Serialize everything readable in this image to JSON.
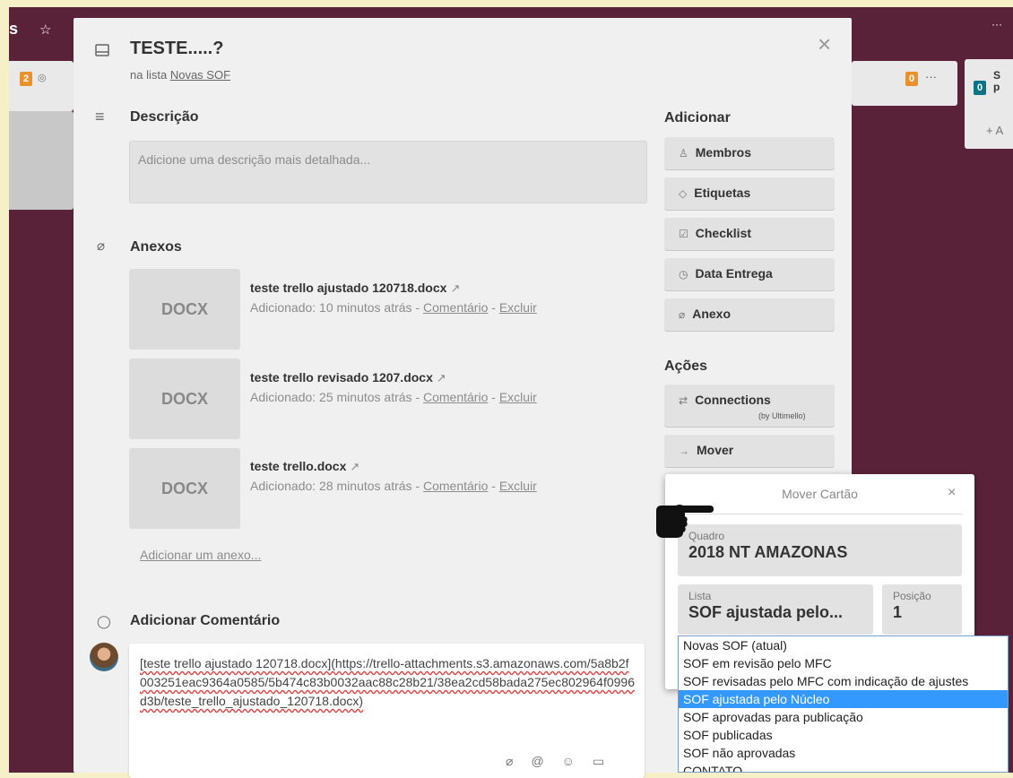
{
  "board": {
    "title_fragment": "s",
    "star": "☆",
    "left_badge": "2",
    "eye": "◎",
    "right_badge": "0",
    "menu_dots": "···",
    "top_dots": "···",
    "far_badge": "0",
    "far_title_fragment": "S\np",
    "far_add": "+ A"
  },
  "card": {
    "icon": "card-icon",
    "title": "TESTE.....?",
    "in_list_prefix": "na lista",
    "list_name": "Novas SOF",
    "close": "×"
  },
  "description": {
    "heading": "Descrição",
    "placeholder": "Adicione uma descrição mais detalhada..."
  },
  "attachments": {
    "heading": "Anexos",
    "items": [
      {
        "thumb": "DOCX",
        "name": "teste trello ajustado 120718.docx",
        "added": "Adicionado: 10 minutos atrás -",
        "comment": "Comentário",
        "sep": "-",
        "delete": "Excluir"
      },
      {
        "thumb": "DOCX",
        "name": "teste trello revisado 1207.docx",
        "added": "Adicionado: 25 minutos atrás -",
        "comment": "Comentário",
        "sep": "-",
        "delete": "Excluir"
      },
      {
        "thumb": "DOCX",
        "name": "teste trello.docx",
        "added": "Adicionado: 28 minutos atrás -",
        "comment": "Comentário",
        "sep": "-",
        "delete": "Excluir"
      }
    ],
    "add_link": "Adicionar um anexo..."
  },
  "comment": {
    "heading": "Adicionar Comentário",
    "text": "[teste trello ajustado 120718.docx](https://trello-attachments.s3.amazonaws.com/5a8b2f003251eac9364a0585/5b474c83b0032aac88c28b21/38ea2cd58bada275ec802964f0996d3b/teste_trello_ajustado_120718.docx)"
  },
  "sidebar": {
    "add_heading": "Adicionar",
    "add_buttons": [
      {
        "icon": "♙",
        "label": "Membros"
      },
      {
        "icon": "◇",
        "label": "Etiquetas"
      },
      {
        "icon": "☑",
        "label": "Checklist"
      },
      {
        "icon": "◷",
        "label": "Data Entrega"
      },
      {
        "icon": "⌀",
        "label": "Anexo"
      }
    ],
    "actions_heading": "Ações",
    "connections": {
      "icon": "⇄",
      "label": "Connections",
      "sub": "(by Ultimello)"
    },
    "move": {
      "icon": "→",
      "label": "Mover"
    }
  },
  "move_popover": {
    "title": "Mover Cartão",
    "close": "×",
    "board_label": "Quadro",
    "board_value": "2018 NT AMAZONAS",
    "list_label": "Lista",
    "list_value": "SOF ajustada pelo...",
    "position_label": "Posição",
    "position_value": "1"
  },
  "list_dropdown": {
    "options": [
      "Novas SOF (atual)",
      "SOF em revisão pelo MFC",
      "SOF revisadas pelo MFC com indicação de ajustes",
      "SOF ajustada pelo Núcleo",
      "SOF aprovadas para publicação",
      "SOF publicadas",
      "SOF não aprovadas",
      "CONTATO"
    ],
    "selected_index": 3
  }
}
